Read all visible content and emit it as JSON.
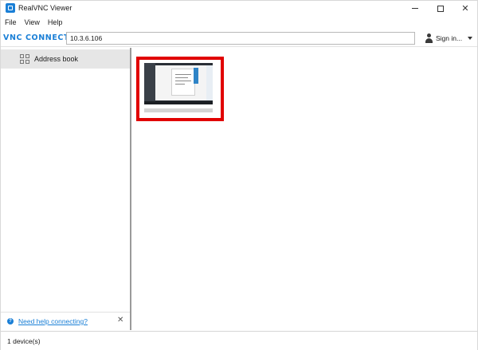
{
  "window": {
    "title": "RealVNC Viewer",
    "controls": {
      "minimize": "–",
      "maximize": "□",
      "close": "✕"
    }
  },
  "menu": [
    "File",
    "View",
    "Help"
  ],
  "toolbar": {
    "brand": "vnc connect",
    "address_value": "10.3.6.106",
    "signin_label": "Sign in..."
  },
  "sidebar": {
    "items": [
      {
        "label": "Address book",
        "icon": "address-book-grid-icon"
      }
    ],
    "help_link": "Need help connecting?",
    "help_close": "✕"
  },
  "main": {
    "devices": [
      {
        "thumbnail": "remote-desktop-thumbnail",
        "selected_highlight": "#e10000"
      }
    ]
  },
  "status": {
    "text": "1 device(s)"
  },
  "colors": {
    "accent": "#1a7fd6",
    "highlight": "#e10000",
    "sidebar_selected": "#e6e6e6"
  }
}
